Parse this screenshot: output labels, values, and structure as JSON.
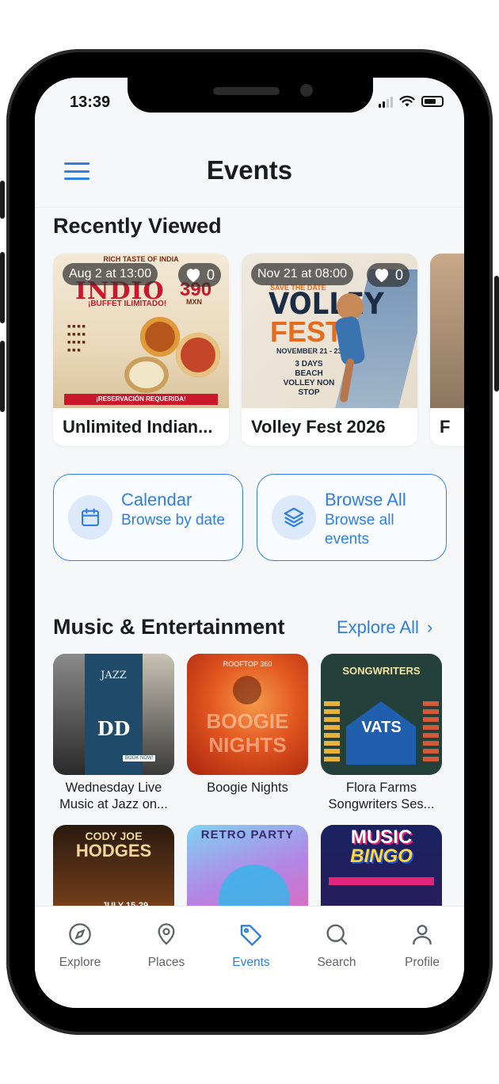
{
  "status": {
    "time": "13:39"
  },
  "header": {
    "title": "Events"
  },
  "recently_viewed": {
    "title": "Recently Viewed",
    "cards": [
      {
        "date": "Aug 2 at 13:00",
        "likes": "0",
        "name": "Unlimited Indian...",
        "poster": {
          "line1": "RICH TASTE OF INDIA",
          "line2": "INDIO",
          "line3": "¡BUFFET ILIMITADO!",
          "price": "390",
          "price_unit": "MXN",
          "footer": "¡RESERVACIÓN REQUERIDA!"
        }
      },
      {
        "date": "Nov 21 at 08:00",
        "likes": "0",
        "name": "Volley Fest 2026",
        "poster": {
          "line1": "SAVE THE DATE",
          "line2": "VOLLEY",
          "line3": "FEST",
          "dates": "NOVEMBER 21 - 23",
          "extra": "3 DAYS BEACH VOLLEY NON STOP"
        }
      },
      {
        "date": "",
        "likes": "",
        "name": "F",
        "poster": {}
      }
    ]
  },
  "quick_actions": [
    {
      "title": "Calendar",
      "subtitle": "Browse by date",
      "icon": "calendar-icon"
    },
    {
      "title": "Browse All",
      "subtitle": "Browse all events",
      "icon": "layers-icon"
    }
  ],
  "music": {
    "title": "Music & Entertainment",
    "explore_all": "Explore All",
    "cards": [
      {
        "title": "Wednesday Live Music at Jazz on...",
        "poster": {
          "top": "JAZZ",
          "mid": "DD",
          "bottom": "BOOK NOW!"
        }
      },
      {
        "title": "Boogie Nights",
        "poster": {
          "top": "ROOFTOP 360",
          "mid": "BOOGIE NIGHTS"
        }
      },
      {
        "title": "Flora Farms Songwriters Ses...",
        "poster": {
          "top": "SONGWRITERS",
          "mid": "VATS"
        }
      },
      {
        "title": "",
        "poster": {
          "top": "CODY JOE",
          "mid": "HODGES",
          "bottom": "JULY 15-29"
        }
      },
      {
        "title": "",
        "poster": {
          "top": "RETRO PARTY"
        }
      },
      {
        "title": "",
        "poster": {
          "top": "MUSIC",
          "mid": "BINGO"
        }
      }
    ]
  },
  "tabbar": {
    "tabs": [
      {
        "label": "Explore",
        "icon": "compass-icon",
        "active": false
      },
      {
        "label": "Places",
        "icon": "map-pin-icon",
        "active": false
      },
      {
        "label": "Events",
        "icon": "tag-icon",
        "active": true
      },
      {
        "label": "Search",
        "icon": "search-icon",
        "active": false
      },
      {
        "label": "Profile",
        "icon": "user-icon",
        "active": false
      }
    ]
  },
  "colors": {
    "accent": "#2f7fe0",
    "background": "#f6f7f9",
    "text": "#1a1c20"
  }
}
